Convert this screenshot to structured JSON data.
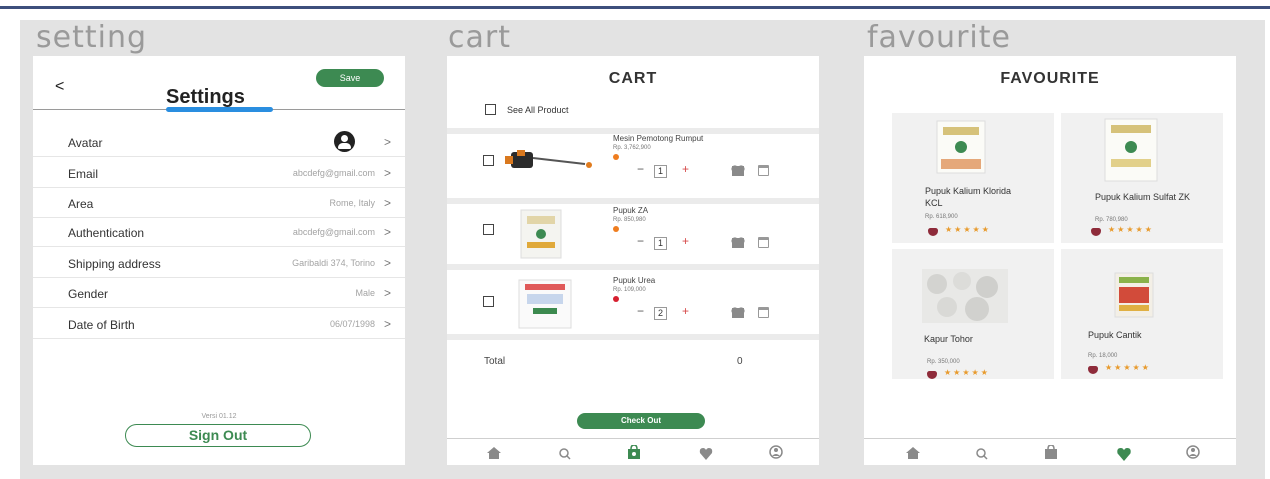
{
  "sections": {
    "setting": "setting",
    "cart": "cart",
    "favourite": "favourite"
  },
  "settings": {
    "back": "<",
    "save": "Save",
    "title": "Settings",
    "rows": [
      {
        "label": "Avatar",
        "value": ""
      },
      {
        "label": "Email",
        "value": "abcdefg@gmail.com"
      },
      {
        "label": "Area",
        "value": "Rome, Italy"
      },
      {
        "label": "Authentication",
        "value": "abcdefg@gmail.com"
      },
      {
        "label": "Shipping address",
        "value": "Garibaldi 374, Torino"
      },
      {
        "label": "Gender",
        "value": "Male"
      },
      {
        "label": "Date of Birth",
        "value": "06/07/1998"
      }
    ],
    "chevron": ">",
    "version": "Versi 01.12",
    "sign_out": "Sign Out"
  },
  "cart": {
    "title": "CART",
    "see_all": "See All Product",
    "items": [
      {
        "name": "Mesin Pemotong Rumput",
        "price": "Rp. 3,762,900",
        "qty": "1",
        "dot_color": "#ef7d1f"
      },
      {
        "name": "Pupuk ZA",
        "price": "Rp. 850,980",
        "qty": "1",
        "dot_color": "#ef7d1f"
      },
      {
        "name": "Pupuk Urea",
        "price": "Rp. 109,000",
        "qty": "2",
        "dot_color": "#d61f2f"
      }
    ],
    "minus": "−",
    "plus": "+",
    "total_label": "Total",
    "total_value": "0",
    "checkout": "Check Out"
  },
  "favourite": {
    "title": "FAVOURITE",
    "items": [
      {
        "name": "Pupuk Kalium Klorida KCL",
        "price": "Rp. 618,900"
      },
      {
        "name": "Pupuk Kalium Sulfat ZK",
        "price": "Rp. 780,980"
      },
      {
        "name": "Kapur Tohor",
        "price": "Rp. 350,000"
      },
      {
        "name": "Pupuk Cantik",
        "price": "Rp. 18,000"
      }
    ],
    "stars": "★★★★★"
  },
  "nav": {
    "home": "home-icon",
    "search": "search-icon",
    "bag": "bag-icon",
    "heart": "heart-icon",
    "profile": "profile-icon"
  },
  "colors": {
    "accent_green": "#3d8a52",
    "underline_blue": "#2a8ee0",
    "fav_heart": "#8e2b3a",
    "star": "#e89a2c"
  }
}
